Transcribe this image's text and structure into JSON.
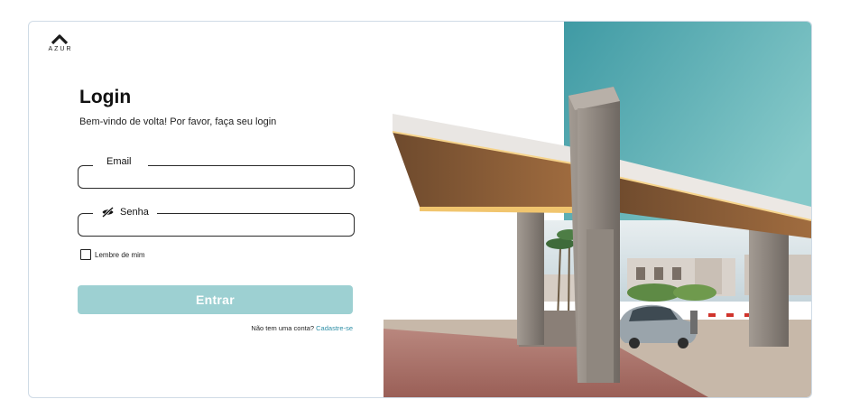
{
  "brand": {
    "name": "AZUR"
  },
  "login": {
    "title": "Login",
    "subtitle": "Bem-vindo de volta! Por favor, faça seu login",
    "email_label": "Email",
    "password_label": "Senha",
    "remember_label": "Lembre de mim",
    "remember_checked": false,
    "submit_label": "Entrar",
    "signup_prompt": "Não tem uma conta?",
    "signup_link": "Cadastre-se"
  },
  "colors": {
    "accent": "#9dd0d2",
    "link": "#2e8fa6",
    "sky": "#5fb0b5"
  },
  "icons": {
    "logo": "azur-chevron-logo",
    "password_toggle": "eye-slash-icon"
  }
}
